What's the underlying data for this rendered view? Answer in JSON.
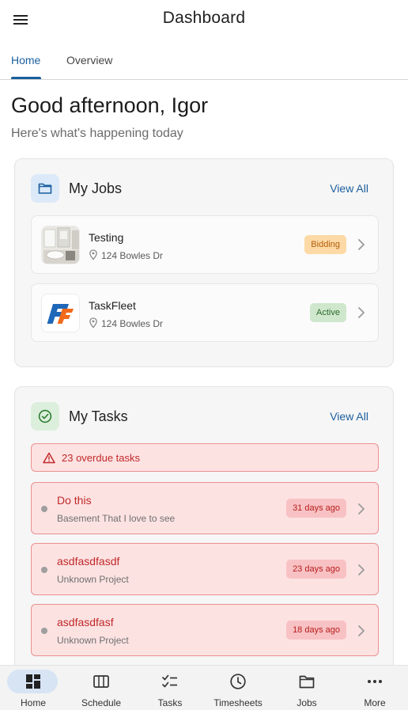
{
  "appbar": {
    "title": "Dashboard",
    "menu_icon": "hamburger-menu-icon"
  },
  "tabs": [
    {
      "label": "Home",
      "active": true
    },
    {
      "label": "Overview",
      "active": false
    }
  ],
  "greeting": {
    "title": "Good afternoon, Igor",
    "subtitle": "Here's what's happening today"
  },
  "my_jobs": {
    "title": "My Jobs",
    "icon": "folder-icon",
    "view_all": "View All",
    "items": [
      {
        "name": "Testing",
        "address": "124 Bowles Dr",
        "status": "Bidding",
        "thumbnail": "bathroom-photo"
      },
      {
        "name": "TaskFleet",
        "address": "124 Bowles Dr",
        "status": "Active",
        "thumbnail": "taskfleet-logo"
      }
    ]
  },
  "my_tasks": {
    "title": "My Tasks",
    "icon": "check-circle-icon",
    "view_all": "View All",
    "overdue_label": "23 overdue tasks",
    "items": [
      {
        "title": "Do this",
        "project": "Basement That I love to see",
        "age": "31 days ago"
      },
      {
        "title": "asdfasdfasdf",
        "project": "Unknown Project",
        "age": "23 days ago"
      },
      {
        "title": "asdfasdfasf",
        "project": "Unknown Project",
        "age": "18 days ago"
      }
    ]
  },
  "bottom_nav": [
    {
      "label": "Home",
      "icon": "dashboard-icon",
      "active": true
    },
    {
      "label": "Schedule",
      "icon": "calendar-columns-icon",
      "active": false
    },
    {
      "label": "Tasks",
      "icon": "checklist-icon",
      "active": false
    },
    {
      "label": "Timesheets",
      "icon": "clock-icon",
      "active": false
    },
    {
      "label": "Jobs",
      "icon": "folder-icon",
      "active": false
    },
    {
      "label": "More",
      "icon": "more-horizontal-icon",
      "active": false
    }
  ],
  "colors": {
    "accent": "#1b5e9e",
    "danger": "#c12929",
    "danger_bg": "#fde2e2",
    "bidding_bg": "#fdd9a6",
    "active_bg": "#cfe7cc"
  }
}
